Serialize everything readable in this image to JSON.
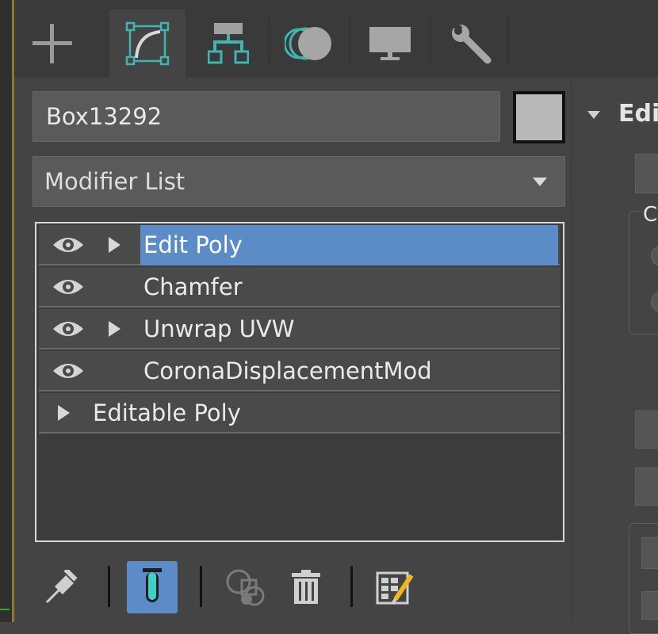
{
  "command_panel": {
    "tabs": [
      {
        "name": "Create",
        "icon": "plus-icon"
      },
      {
        "name": "Modify",
        "icon": "modify-curve-icon",
        "active": true
      },
      {
        "name": "Hierarchy",
        "icon": "hierarchy-icon"
      },
      {
        "name": "Motion",
        "icon": "motion-icon"
      },
      {
        "name": "Display",
        "icon": "display-monitor-icon"
      },
      {
        "name": "Utilities",
        "icon": "wrench-icon"
      }
    ],
    "object_name": "Box13292",
    "object_color": "#b8b8b8",
    "modifier_list_label": "Modifier List",
    "stack": [
      {
        "label": "Edit Poly",
        "visible": true,
        "expandable": true,
        "selected": true
      },
      {
        "label": "Chamfer",
        "visible": true,
        "expandable": false,
        "selected": false
      },
      {
        "label": "Unwrap UVW",
        "visible": true,
        "expandable": true,
        "selected": false
      },
      {
        "label": "CoronaDisplacementMod",
        "visible": true,
        "expandable": false,
        "selected": false
      },
      {
        "label": "Editable Poly",
        "visible": false,
        "expandable": true,
        "selected": false
      }
    ],
    "bottom_toolbar": [
      {
        "name": "Pin Stack",
        "icon": "pin-icon"
      },
      {
        "name": "Show End Result",
        "icon": "end-result-icon",
        "active": true
      },
      {
        "name": "Make Unique",
        "icon": "make-unique-icon",
        "disabled": true
      },
      {
        "name": "Remove Modifier",
        "icon": "trash-icon"
      },
      {
        "name": "Configure Modifier Sets",
        "icon": "configure-sets-icon"
      }
    ]
  },
  "rollout": {
    "title": "Edi",
    "group_label": "C"
  },
  "colors": {
    "selection": "#5b8cc8",
    "panel_bg": "#444444",
    "field_bg": "#5a5a5a",
    "accent_teal": "#3fb6b2"
  }
}
